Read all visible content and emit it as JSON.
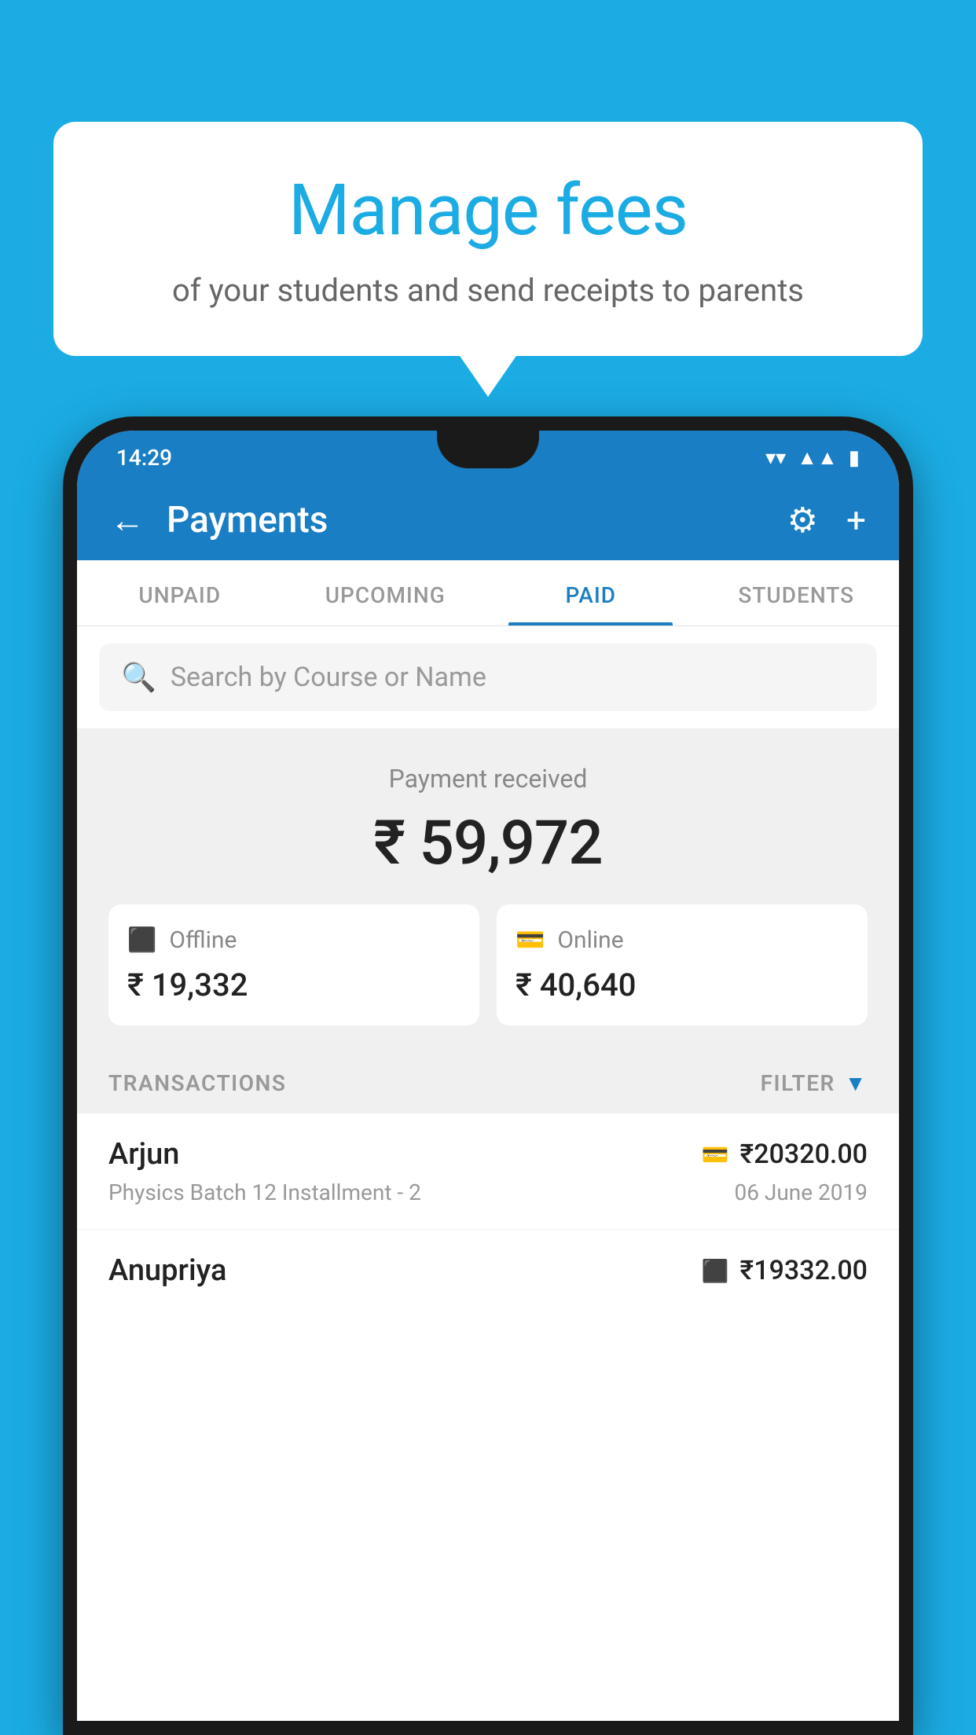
{
  "bubble": {
    "title": "Manage fees",
    "subtitle": "of your students and send receipts to parents"
  },
  "status_bar": {
    "time": "14:29",
    "icons": {
      "wifi": "▼",
      "signal": "▲",
      "battery": "▮"
    }
  },
  "header": {
    "title": "Payments",
    "back_label": "←",
    "gear_label": "⚙",
    "plus_label": "+"
  },
  "tabs": [
    {
      "label": "UNPAID",
      "active": false
    },
    {
      "label": "UPCOMING",
      "active": false
    },
    {
      "label": "PAID",
      "active": true
    },
    {
      "label": "STUDENTS",
      "active": false
    }
  ],
  "search": {
    "placeholder": "Search by Course or Name"
  },
  "payment_summary": {
    "label": "Payment received",
    "total": "₹ 59,972",
    "offline": {
      "label": "Offline",
      "amount": "₹ 19,332"
    },
    "online": {
      "label": "Online",
      "amount": "₹ 40,640"
    }
  },
  "transactions": {
    "label": "TRANSACTIONS",
    "filter_label": "FILTER",
    "items": [
      {
        "name": "Arjun",
        "amount": "₹20320.00",
        "description": "Physics Batch 12 Installment - 2",
        "date": "06 June 2019",
        "payment_type": "online"
      },
      {
        "name": "Anupriya",
        "amount": "₹19332.00",
        "description": "",
        "date": "",
        "payment_type": "offline"
      }
    ]
  }
}
